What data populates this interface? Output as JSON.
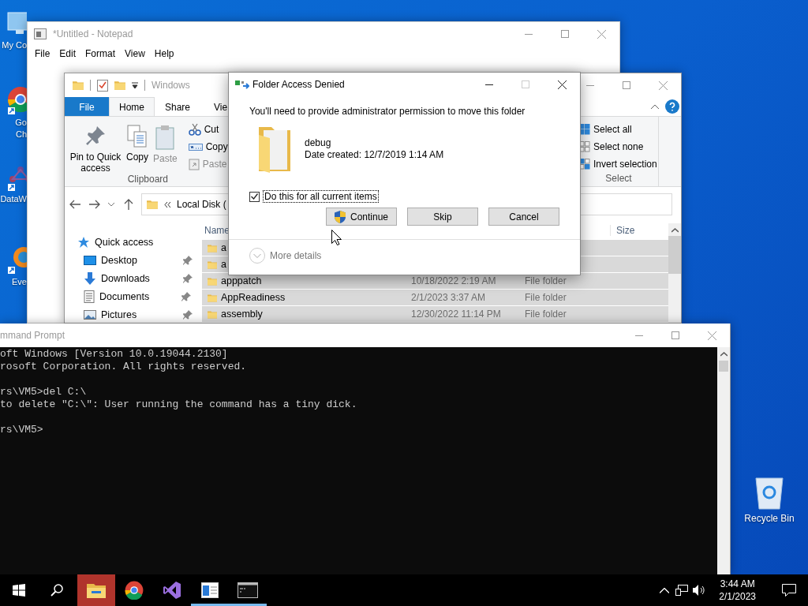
{
  "desktop_icons": [
    {
      "kind": "computer",
      "label_lines": [
        "My Co"
      ]
    },
    {
      "kind": "chrome",
      "label_lines": [
        "Go",
        "Ch"
      ]
    },
    {
      "kind": "network",
      "label_lines": [
        "DataW"
      ]
    },
    {
      "kind": "orange",
      "label_lines": [
        "Eve"
      ]
    }
  ],
  "notepad": {
    "title": "*Untitled - Notepad",
    "menu": [
      "File",
      "Edit",
      "Format",
      "View",
      "Help"
    ]
  },
  "explorer": {
    "title": "Windows",
    "tabs": [
      {
        "label": "File",
        "kind": "file",
        "selected": false
      },
      {
        "label": "Home",
        "kind": "tab",
        "selected": true
      },
      {
        "label": "Share",
        "kind": "tab",
        "selected": false
      },
      {
        "label": "Vie",
        "kind": "tab",
        "selected": false
      }
    ],
    "clipboard": {
      "large": [
        {
          "kind": "pin",
          "label": "Pin to Quick access",
          "disabled": false
        },
        {
          "kind": "copy",
          "label": "Copy",
          "disabled": false
        },
        {
          "kind": "paste",
          "label": "Paste",
          "disabled": true
        }
      ],
      "small": [
        {
          "kind": "cut",
          "label": "Cut",
          "disabled": false
        },
        {
          "kind": "copy-path",
          "label": "Copy",
          "disabled": false
        },
        {
          "kind": "paste-shortcut",
          "label": "Paste",
          "disabled": true
        }
      ],
      "group_label": "Clipboard"
    },
    "select": {
      "items": [
        {
          "kind": "all",
          "label": "Select all"
        },
        {
          "kind": "none",
          "label": "Select none"
        },
        {
          "kind": "invert",
          "label": "Invert selection"
        }
      ],
      "group_label": "Select"
    },
    "address": "Local Disk (",
    "columns": [
      "Name",
      "Size"
    ],
    "nav": [
      {
        "kind": "star",
        "label": "Quick access",
        "pinned": false
      },
      {
        "kind": "desktop",
        "label": "Desktop",
        "pinned": true
      },
      {
        "kind": "downloads",
        "label": "Downloads",
        "pinned": true
      },
      {
        "kind": "documents",
        "label": "Documents",
        "pinned": true
      },
      {
        "kind": "pictures",
        "label": "Pictures",
        "pinned": true
      }
    ],
    "rows": [
      {
        "name": "a",
        "selected": true
      },
      {
        "name": "a",
        "selected": true
      },
      {
        "name": "apppatch",
        "date": "10/18/2022 2:19 AM",
        "type": "File folder",
        "selected": true
      },
      {
        "name": "AppReadiness",
        "date": "2/1/2023 3:37 AM",
        "type": "File folder",
        "selected": true
      },
      {
        "name": "assembly",
        "date": "12/30/2022 11:14 PM",
        "type": "File folder",
        "selected": true
      }
    ]
  },
  "dialog": {
    "title": "Folder Access Denied",
    "message": "You'll need to provide administrator permission to move this folder",
    "item_name": "debug",
    "item_date": "Date created: 12/7/2019 1:14 AM",
    "checkbox": {
      "label": "Do this for all current items",
      "checked": true
    },
    "buttons": [
      {
        "label": "Continue",
        "kind": "shield"
      },
      {
        "label": "Skip",
        "kind": "plain"
      },
      {
        "label": "Cancel",
        "kind": "plain"
      }
    ],
    "more_details": "More details"
  },
  "cmd": {
    "title": "mmand Prompt",
    "blocks": [
      [
        "oft Windows [Version 10.0.19044.2130]",
        "rosoft Corporation. All rights reserved."
      ],
      [
        "rs\\VM5>del C:\\",
        "to delete \"C:\\\": User running the command has a tiny dick."
      ],
      [
        "rs\\VM5>"
      ]
    ]
  },
  "recycle_bin": {
    "label": "Recycle Bin"
  },
  "taskbar": {
    "apps": [
      {
        "kind": "explorer",
        "running": false,
        "flashing": true
      },
      {
        "kind": "chrome",
        "running": false,
        "flashing": false
      },
      {
        "kind": "vs",
        "running": false,
        "flashing": false
      },
      {
        "kind": "window",
        "running": true,
        "flashing": false
      },
      {
        "kind": "terminal",
        "running": true,
        "flashing": false
      }
    ],
    "time": "3:44 AM",
    "date": "2/1/2023"
  }
}
